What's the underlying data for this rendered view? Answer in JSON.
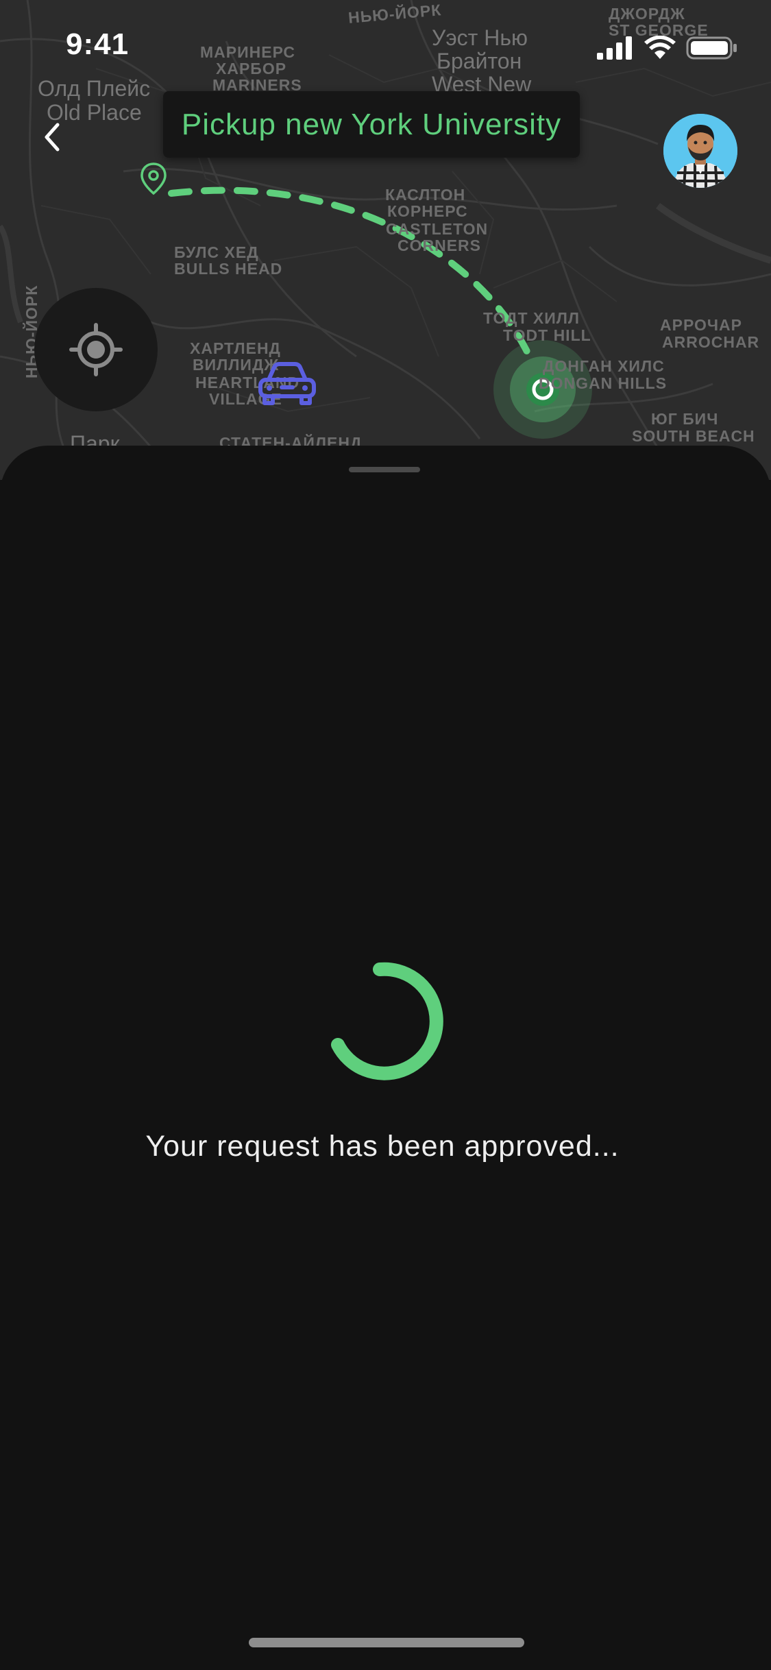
{
  "status_bar": {
    "time": "9:41"
  },
  "map": {
    "labels": [
      {
        "text": "НЬЮ-ЙОРК"
      },
      {
        "text": "Олд Плейс"
      },
      {
        "text": "Old Place"
      },
      {
        "text": "МАРИНЕРС"
      },
      {
        "text": "ХАРБОР"
      },
      {
        "text": "MARINERS"
      },
      {
        "text": "Уэст Нью"
      },
      {
        "text": "Брайтон"
      },
      {
        "text": "West New"
      },
      {
        "text": "ДЖОРДЖ"
      },
      {
        "text": "ST GEORGE"
      },
      {
        "text": "КАСЛТОН"
      },
      {
        "text": "КОРНЕРС"
      },
      {
        "text": "CASTLETON"
      },
      {
        "text": "CORNERS"
      },
      {
        "text": "БУЛС ХЕД"
      },
      {
        "text": "BULLS HEAD"
      },
      {
        "text": "НЬЮ-ЙОРК"
      },
      {
        "text": "ТОДТ ХИЛЛ"
      },
      {
        "text": "TODT HILL"
      },
      {
        "text": "АРРОЧАР"
      },
      {
        "text": "ARROCHAR"
      },
      {
        "text": "ХАРТЛЕНД"
      },
      {
        "text": "ВИЛЛИДЖ"
      },
      {
        "text": "HEARTLAND"
      },
      {
        "text": "VILLAGE"
      },
      {
        "text": "ДОНГАН ХИЛС"
      },
      {
        "text": "DONGAN HILLS"
      },
      {
        "text": "ЮГ БИЧ"
      },
      {
        "text": "SOUTH BEACH"
      },
      {
        "text": "Парк"
      },
      {
        "text": "СТАТЕН-АЙЛЕНД"
      }
    ]
  },
  "pickup": {
    "label": "Pickup new York University"
  },
  "sheet": {
    "status_message": "Your request has been approved..."
  },
  "colors": {
    "accent": "#5fcf7d",
    "car": "#5b5fe0",
    "sheet_bg": "#121212",
    "map_bg": "#2c2c2c"
  },
  "icons": {
    "back": "chevron-left-icon",
    "pin": "location-pin-icon",
    "car": "car-icon",
    "locate": "crosshair-icon",
    "destination": "destination-marker-icon",
    "signal": "cellular-signal-icon",
    "wifi": "wifi-icon",
    "battery": "battery-icon"
  }
}
